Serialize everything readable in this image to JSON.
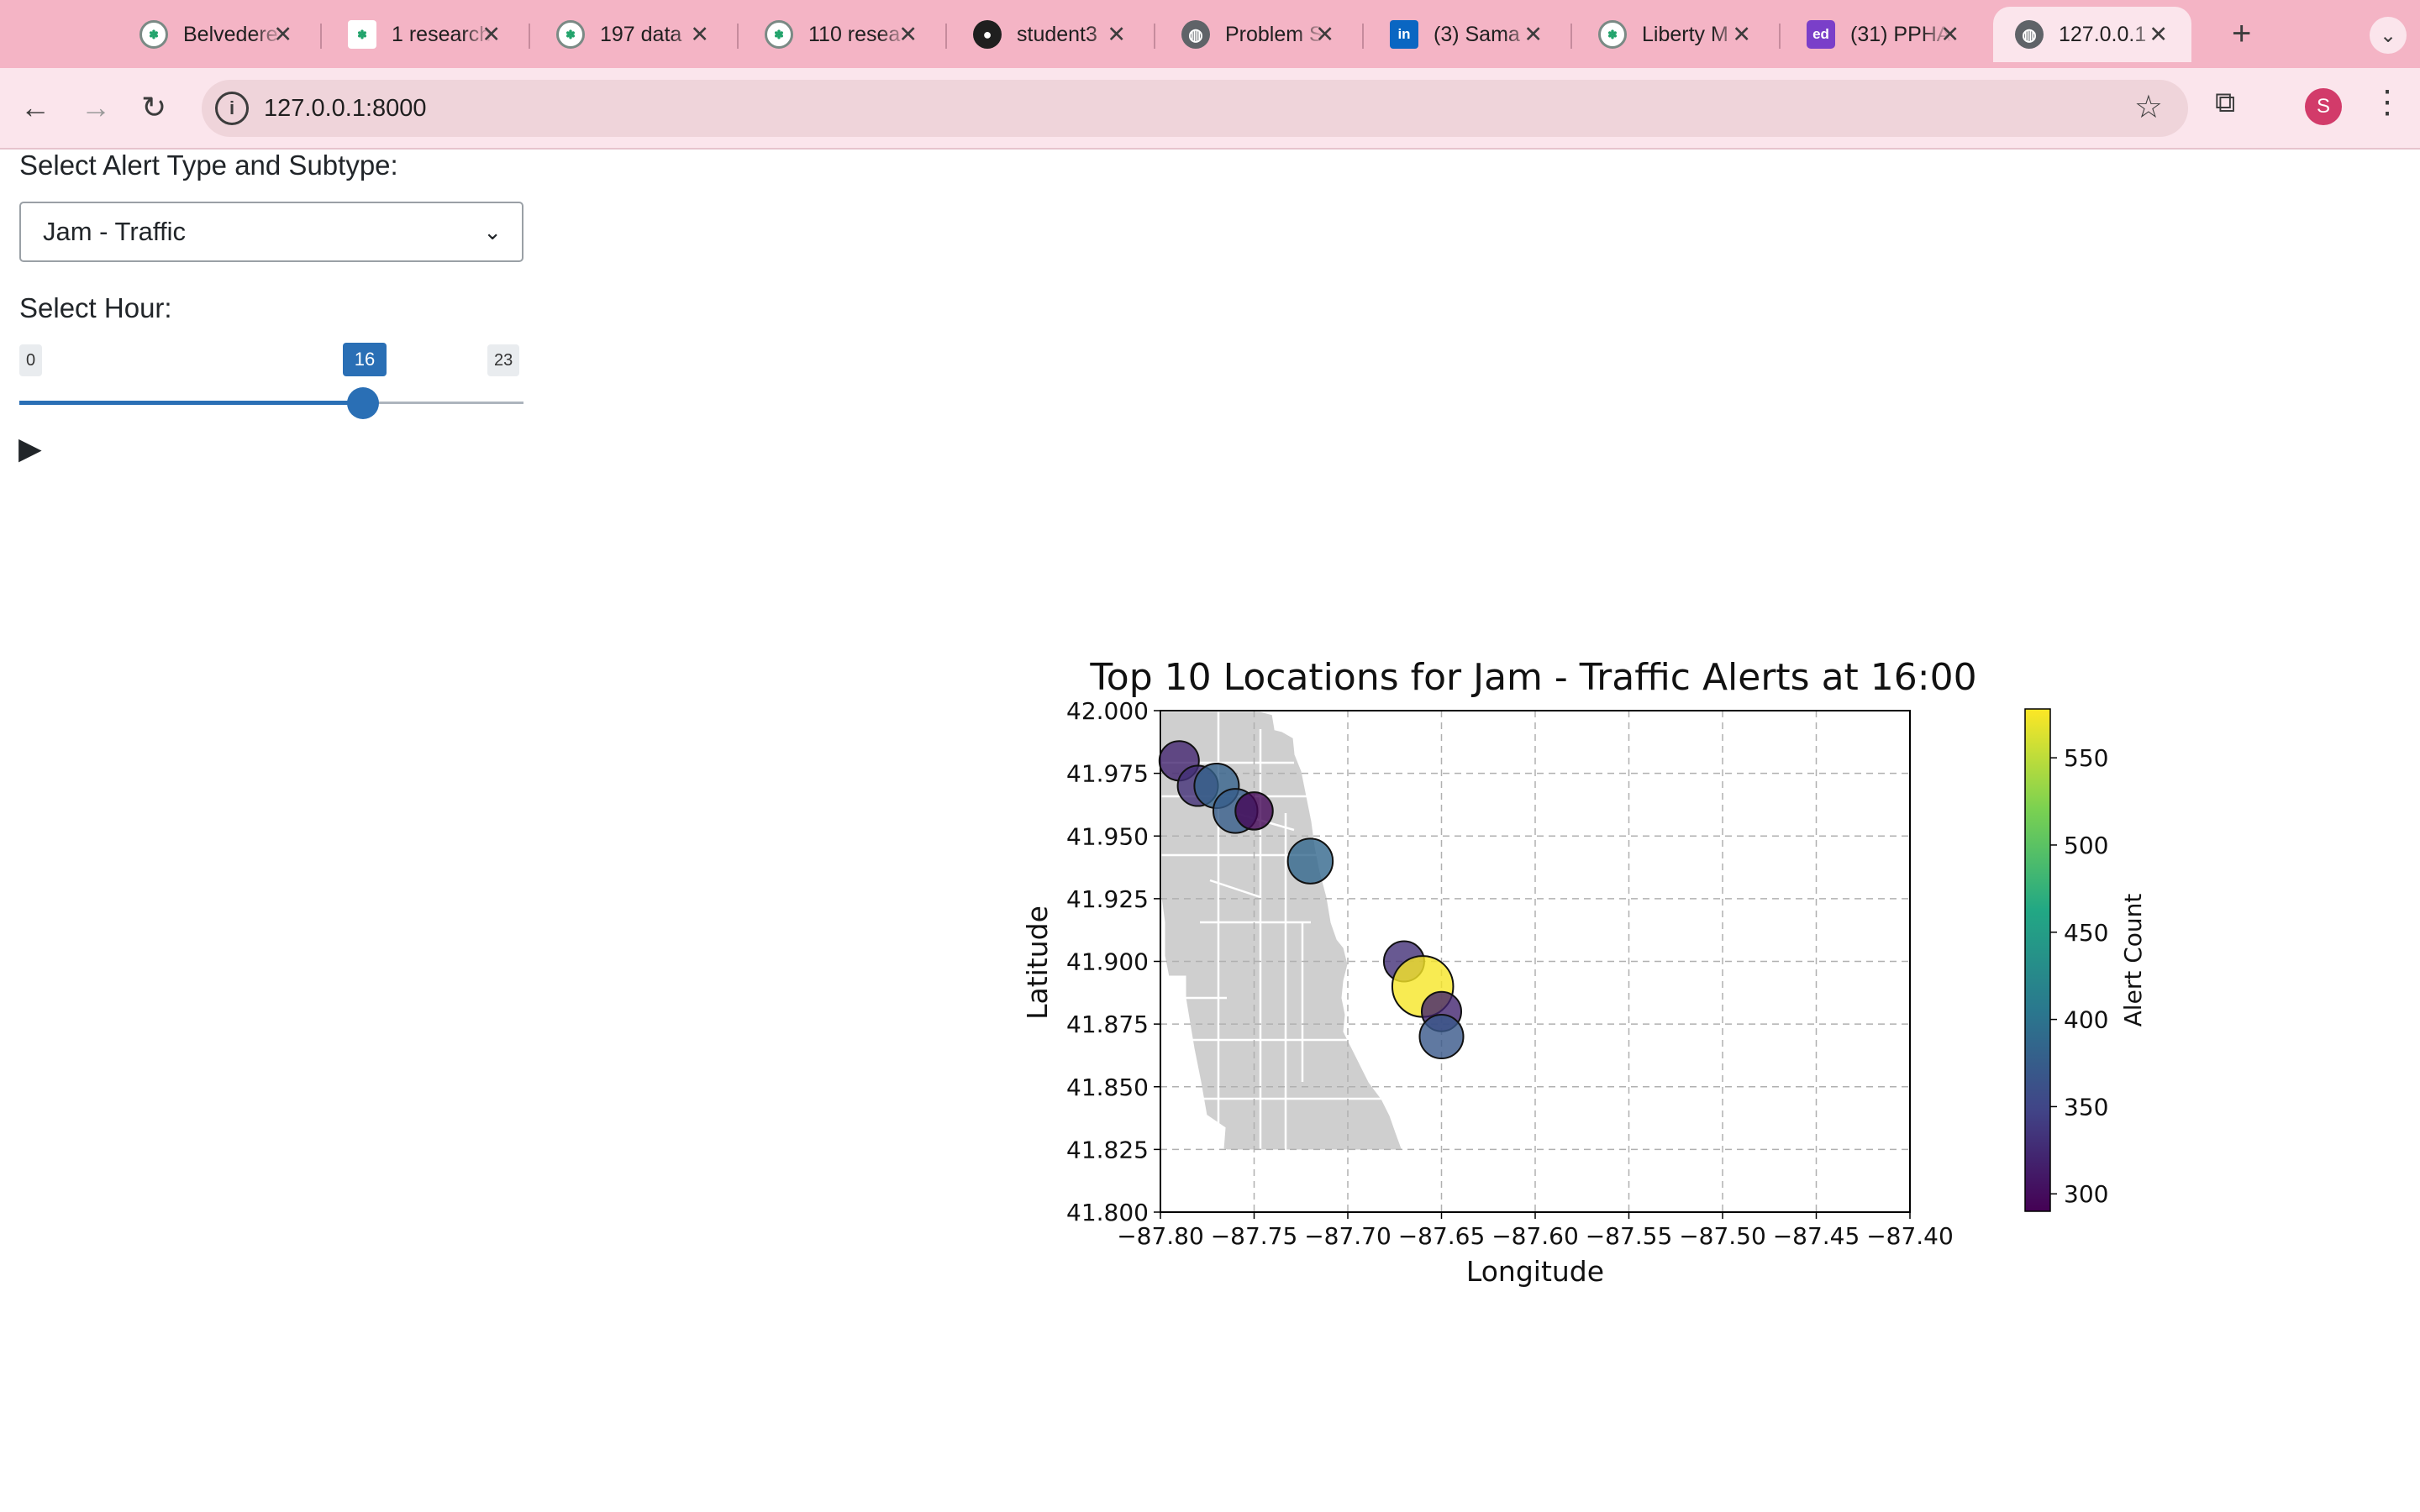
{
  "browser": {
    "tabs": [
      {
        "title": "Belvedere",
        "icon": "wiki-icon",
        "active": false
      },
      {
        "title": "1 research",
        "icon": "doc-icon",
        "active": false
      },
      {
        "title": "197 data",
        "icon": "wiki-icon",
        "active": false
      },
      {
        "title": "110 resea",
        "icon": "wiki-icon",
        "active": false
      },
      {
        "title": "student3",
        "icon": "github-icon",
        "active": false
      },
      {
        "title": "Problem S",
        "icon": "globe-icon",
        "active": false
      },
      {
        "title": "(3) Sama",
        "icon": "linkedin-icon",
        "active": false
      },
      {
        "title": "Liberty M",
        "icon": "wiki-icon",
        "active": false
      },
      {
        "title": "(31) PPHA",
        "icon": "ed-icon",
        "active": false
      },
      {
        "title": "127.0.0.1",
        "icon": "globe-icon",
        "active": true
      }
    ],
    "url": "127.0.0.1:8000",
    "profile_initial": "S",
    "accent": "#f4b4c5"
  },
  "controls": {
    "alert_label": "Select Alert Type and Subtype:",
    "alert_value": "Jam - Traffic",
    "hour_label": "Select Hour:",
    "hour_min": "0",
    "hour_max": "23",
    "hour_value": "16"
  },
  "chart_data": {
    "type": "scatter",
    "title": "Top 10 Locations for Jam - Traffic Alerts at 16:00",
    "xlabel": "Longitude",
    "ylabel": "Latitude",
    "xlim": [
      -87.8,
      -87.4
    ],
    "ylim": [
      41.8,
      42.0
    ],
    "xticks": [
      "−87.80",
      "−87.75",
      "−87.70",
      "−87.65",
      "−87.60",
      "−87.55",
      "−87.50",
      "−87.45",
      "−87.40"
    ],
    "yticks": [
      "41.800",
      "41.825",
      "41.850",
      "41.875",
      "41.900",
      "41.925",
      "41.950",
      "41.975",
      "42.000"
    ],
    "grid": true,
    "colorbar": {
      "label": "Alert Count",
      "ticks": [
        "300",
        "350",
        "400",
        "450",
        "500",
        "550"
      ],
      "min": 290,
      "max": 578,
      "colormap": "viridis"
    },
    "points": [
      {
        "x": -87.79,
        "y": 41.98,
        "count": 320
      },
      {
        "x": -87.78,
        "y": 41.97,
        "count": 330
      },
      {
        "x": -87.77,
        "y": 41.97,
        "count": 380
      },
      {
        "x": -87.76,
        "y": 41.96,
        "count": 375
      },
      {
        "x": -87.75,
        "y": 41.96,
        "count": 295
      },
      {
        "x": -87.72,
        "y": 41.94,
        "count": 385
      },
      {
        "x": -87.67,
        "y": 41.9,
        "count": 330
      },
      {
        "x": -87.66,
        "y": 41.89,
        "count": 575
      },
      {
        "x": -87.65,
        "y": 41.88,
        "count": 320
      },
      {
        "x": -87.65,
        "y": 41.87,
        "count": 370
      }
    ]
  }
}
